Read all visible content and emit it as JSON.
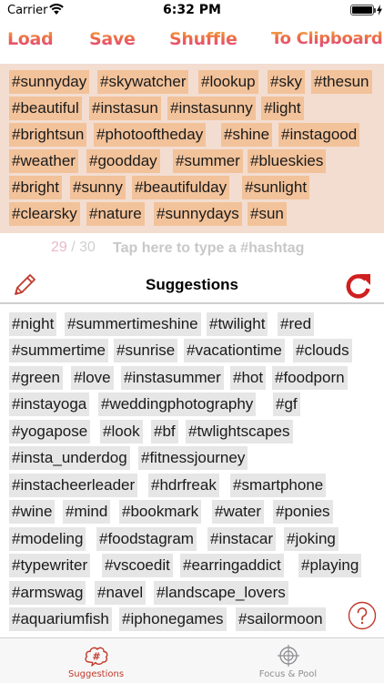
{
  "status_bar": {
    "carrier": "Carrier",
    "time": "6:32 PM",
    "battery": 1.0
  },
  "toolbar": {
    "load": "Load",
    "save": "Save",
    "shuffle": "Shuffle",
    "clipboard": "To Clipboard"
  },
  "selected_tags": [
    "#sunnyday",
    "#skywatcher",
    "#lookup",
    "#sky",
    "#thesun",
    "#beautiful",
    "#instasun",
    "#instasunny",
    "#light",
    "#brightsun",
    "#photooftheday",
    "#shine",
    "#instagood",
    "#weather",
    "#goodday",
    "#summer",
    "#blueskies",
    "#bright",
    "#sunny",
    "#beautifulday",
    "#sunlight",
    "#clearsky",
    "#nature",
    "#sunnydays",
    "#sun"
  ],
  "counter": {
    "count": "29",
    "separator": " / ",
    "max": "30"
  },
  "input": {
    "placeholder": "Tap here to type a #hashtag"
  },
  "suggestions": {
    "title": "Suggestions",
    "tags": [
      "#night",
      "#summertimeshine",
      "#twilight",
      "#red",
      "#summertime",
      "#sunrise",
      "#vacationtime",
      "#clouds",
      "#green",
      "#love",
      "#instasummer",
      "#hot",
      "#foodporn",
      "#instayoga",
      "#weddingphotography",
      "#gf",
      "#yogapose",
      "#look",
      "#bf",
      "#twlightscapes",
      "#insta_underdog",
      "#fitnessjourney",
      "#instacheerleader",
      "#hdrfreak",
      "#smartphone",
      "#wine",
      "#mind",
      "#bookmark",
      "#water",
      "#ponies",
      "#modeling",
      "#foodstagram",
      "#instacar",
      "#joking",
      "#typewriter",
      "#vscoedit",
      "#earringaddict",
      "#playing",
      "#armswag",
      "#navel",
      "#landscape_lovers",
      "#aquariumfish",
      "#iphonegames",
      "#sailormoon"
    ]
  },
  "tab_bar": {
    "tabs": [
      {
        "label": "Suggestions",
        "icon": "hashtag-cloud-icon",
        "active": true
      },
      {
        "label": "Focus & Pool",
        "icon": "crosshair-icon",
        "active": false
      }
    ]
  },
  "colors": {
    "selected_tag_bg": "#f2c29a",
    "selected_area_bg": "#f3ddd1",
    "suggestion_tag_bg": "#e6e6e6",
    "accent_red": "#c0392b",
    "counter_pink": "#e7b9c8"
  }
}
